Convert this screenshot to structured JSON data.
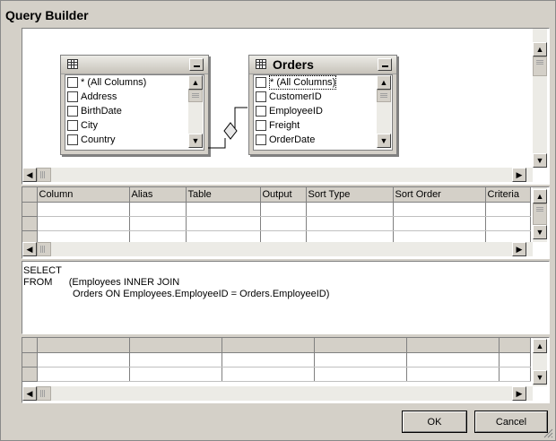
{
  "window": {
    "title": "Query Builder"
  },
  "diagram": {
    "tables": [
      {
        "name": "",
        "columns": [
          "* (All Columns)",
          "Address",
          "BirthDate",
          "City",
          "Country"
        ]
      },
      {
        "name": "Orders",
        "columns": [
          "* (All Columns)",
          "CustomerID",
          "EmployeeID",
          "Freight",
          "OrderDate"
        ]
      }
    ],
    "join_icon": "diamond-join-icon"
  },
  "criteria_grid": {
    "headers": [
      "Column",
      "Alias",
      "Table",
      "Output",
      "Sort Type",
      "Sort Order",
      "Criteria"
    ]
  },
  "sql_pane": {
    "line1": "SELECT",
    "line2": "FROM      (Employees INNER JOIN",
    "line3": "                  Orders ON Employees.EmployeeID = Orders.EmployeeID)"
  },
  "buttons": {
    "ok": "OK",
    "cancel": "Cancel"
  },
  "icons": {
    "scroll_up": "▲",
    "scroll_down": "▼",
    "scroll_left": "◀",
    "scroll_right": "▶"
  }
}
